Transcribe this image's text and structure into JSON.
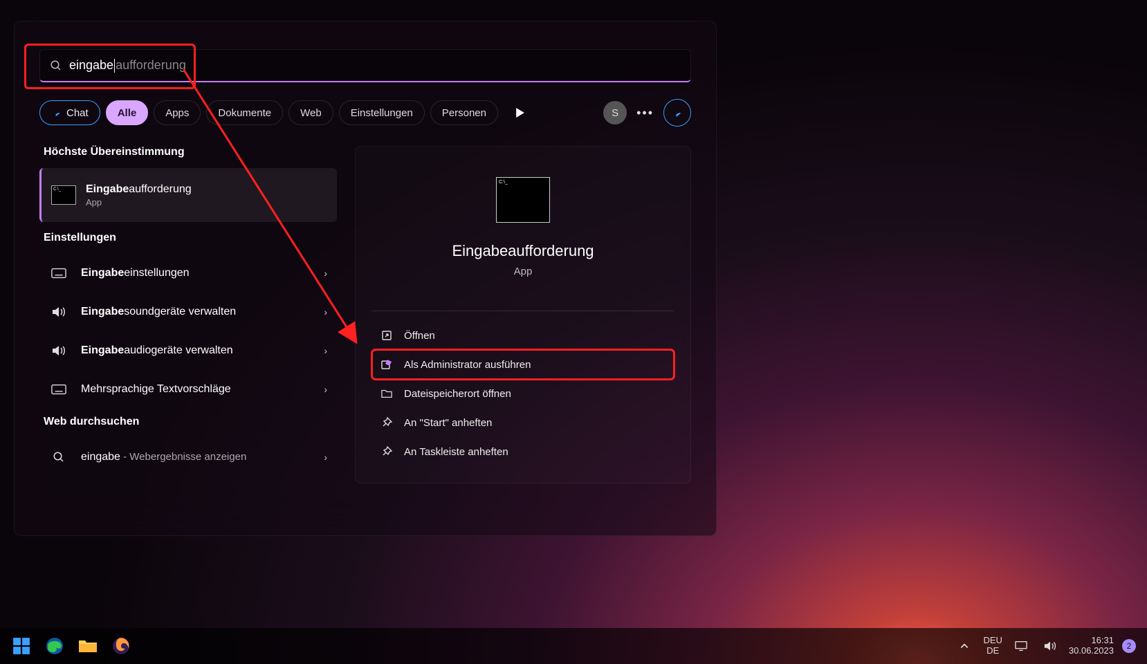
{
  "search": {
    "typed": "eingabe",
    "suggestion_suffix": "aufforderung"
  },
  "filters": {
    "chat": "Chat",
    "alle": "Alle",
    "apps": "Apps",
    "dokumente": "Dokumente",
    "web": "Web",
    "einstellungen": "Einstellungen",
    "personen": "Personen",
    "avatar_initial": "S"
  },
  "left": {
    "best_match_header": "Höchste Übereinstimmung",
    "best": {
      "title_bold": "Eingabe",
      "title_rest": "aufforderung",
      "subtitle": "App"
    },
    "settings_header": "Einstellungen",
    "settings_items": [
      {
        "bold": "Eingabe",
        "rest": "einstellungen",
        "icon": "keyboard"
      },
      {
        "bold": "Eingabe",
        "rest": "soundgeräte verwalten",
        "icon": "sound"
      },
      {
        "bold": "Eingabe",
        "rest": "audiogeräte verwalten",
        "icon": "sound"
      },
      {
        "bold": "",
        "rest": "Mehrsprachige Textvorschläge",
        "icon": "keyboard"
      }
    ],
    "web_header": "Web durchsuchen",
    "web_item": {
      "term": "eingabe",
      "suffix": " - Webergebnisse anzeigen"
    }
  },
  "right": {
    "app_name": "Eingabeaufforderung",
    "app_kind": "App",
    "actions": [
      {
        "label": "Öffnen",
        "icon": "open"
      },
      {
        "label": "Als Administrator ausführen",
        "icon": "admin",
        "highlight": true
      },
      {
        "label": "Dateispeicherort öffnen",
        "icon": "folder"
      },
      {
        "label": "An \"Start\" anheften",
        "icon": "pin"
      },
      {
        "label": "An Taskleiste anheften",
        "icon": "pin"
      }
    ]
  },
  "taskbar": {
    "lang_top": "DEU",
    "lang_bottom": "DE",
    "time": "16:31",
    "date": "30.06.2023",
    "notif_count": "2"
  }
}
